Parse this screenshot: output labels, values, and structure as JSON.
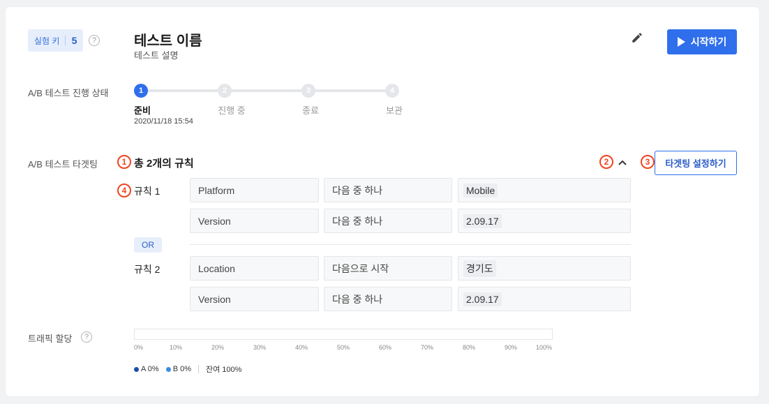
{
  "header": {
    "experiment_key_label": "실험 키",
    "experiment_key_value": "5",
    "help_glyph": "?",
    "test_name": "테스트 이름",
    "test_description": "테스트 설명",
    "start_button_label": "시작하기",
    "edit_icon": "pencil-icon"
  },
  "progress": {
    "label": "A/B 테스트 진행 상태",
    "current_step": 1,
    "steps": [
      {
        "num": "1",
        "label": "준비",
        "date": "2020/11/18 15:54"
      },
      {
        "num": "2",
        "label": "진행 중"
      },
      {
        "num": "3",
        "label": "종료"
      },
      {
        "num": "4",
        "label": "보관"
      }
    ]
  },
  "targeting": {
    "label": "A/B 테스트 타겟팅",
    "rules_summary": "총 2개의 규칙",
    "setup_button_label": "타겟팅 설정하기",
    "annotations": [
      "1",
      "2",
      "3",
      "4"
    ],
    "or_label": "OR",
    "rules": [
      {
        "name": "규칙 1",
        "conditions": [
          {
            "field": "Platform",
            "operator": "다음 중 하나",
            "value": "Mobile"
          },
          {
            "field": "Version",
            "operator": "다음 중 하나",
            "value": "2.09.17"
          }
        ]
      },
      {
        "name": "규칙 2",
        "conditions": [
          {
            "field": "Location",
            "operator": "다음으로 시작",
            "value": "경기도"
          },
          {
            "field": "Version",
            "operator": "다음 중 하나",
            "value": "2.09.17"
          }
        ]
      }
    ]
  },
  "traffic": {
    "label": "트래픽 할당",
    "ticks": [
      "0%",
      "10%",
      "20%",
      "30%",
      "40%",
      "50%",
      "60%",
      "70%",
      "80%",
      "90%",
      "100%"
    ],
    "legend": {
      "a_label": "A 0%",
      "b_label": "B 0%",
      "remaining_label": "잔여 100%",
      "a_color": "#1d4fa8",
      "b_color": "#3b8de0"
    }
  },
  "colors": {
    "accent": "#2f6fec",
    "annotation": "#f0441f"
  }
}
